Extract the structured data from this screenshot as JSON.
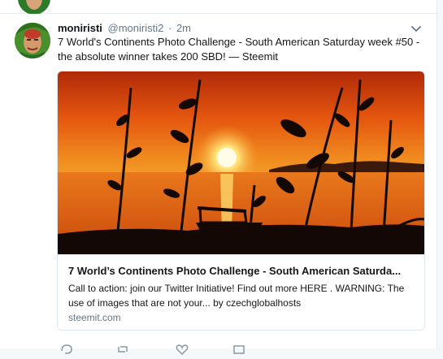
{
  "tweet": {
    "username": "moniristi",
    "handle": "@moniristi2",
    "separator": "·",
    "time": "2m",
    "text": "7 World's Continents Photo Challenge - South American Saturday week #50 - the absolute winner takes 200 SBD! — Steemit",
    "avatar_icon": "profile-avatar",
    "menu_icon": "chevron-down-icon"
  },
  "card": {
    "title": "7 World’s Continents Photo Challenge - South American Saturda...",
    "description": "Call to action: join our Twitter Initiative! Find out more HERE . WARNING: The use of images that are not your... by czechglobalhosts",
    "domain": "steemit.com",
    "image_subject": "sunset-over-river-silhouette"
  },
  "actions": {
    "reply_icon": "reply-icon",
    "retweet_icon": "retweet-icon",
    "like_icon": "heart-icon",
    "dm_icon": "envelope-icon"
  },
  "colors": {
    "accent_text": "#14171a",
    "muted_text": "#657786",
    "border": "#e1e8ed",
    "background": "#f5f8fa"
  }
}
